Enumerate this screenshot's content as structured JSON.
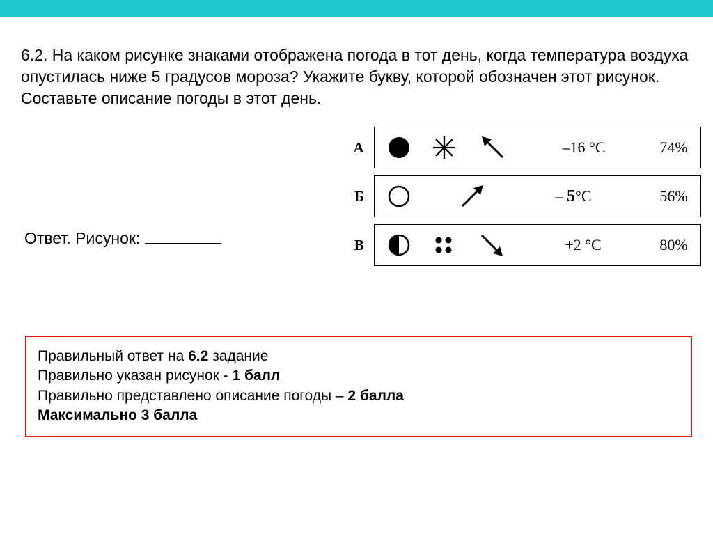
{
  "question": "6.2. На каком рисунке знаками отображена погода в тот день, когда температура воздуха опустилась ниже 5 градусов мороза? Укажите букву, которой обозначен этот рисунок. Составьте описание погоды в этот день.",
  "answer_label": "Ответ. Рисунок: ",
  "options": [
    {
      "letter": "А",
      "cloud_icon": "filled-circle",
      "precip_icon": "snowflake",
      "wind_icon": "arrow-nw",
      "temp": "–16 °C",
      "humidity": "74%"
    },
    {
      "letter": "Б",
      "cloud_icon": "empty-circle",
      "precip_icon": null,
      "wind_icon": "arrow-ne",
      "temp_prefix": "– ",
      "temp_num": "5",
      "temp_suffix": "°C",
      "humidity": "56%"
    },
    {
      "letter": "В",
      "cloud_icon": "half-circle",
      "precip_icon": "four-dots",
      "wind_icon": "arrow-se",
      "temp": "+2 °C",
      "humidity": "80%"
    }
  ],
  "scoring": {
    "line1_pre": "Правильный ответ на ",
    "line1_bold": "6.2",
    "line1_post": " задание",
    "line2_pre": "Правильно указан рисунок - ",
    "line2_bold": "1 балл",
    "line3_pre": "Правильно представлено описание погоды – ",
    "line3_bold": "2 балла",
    "line4": "Максимально 3 балла"
  }
}
